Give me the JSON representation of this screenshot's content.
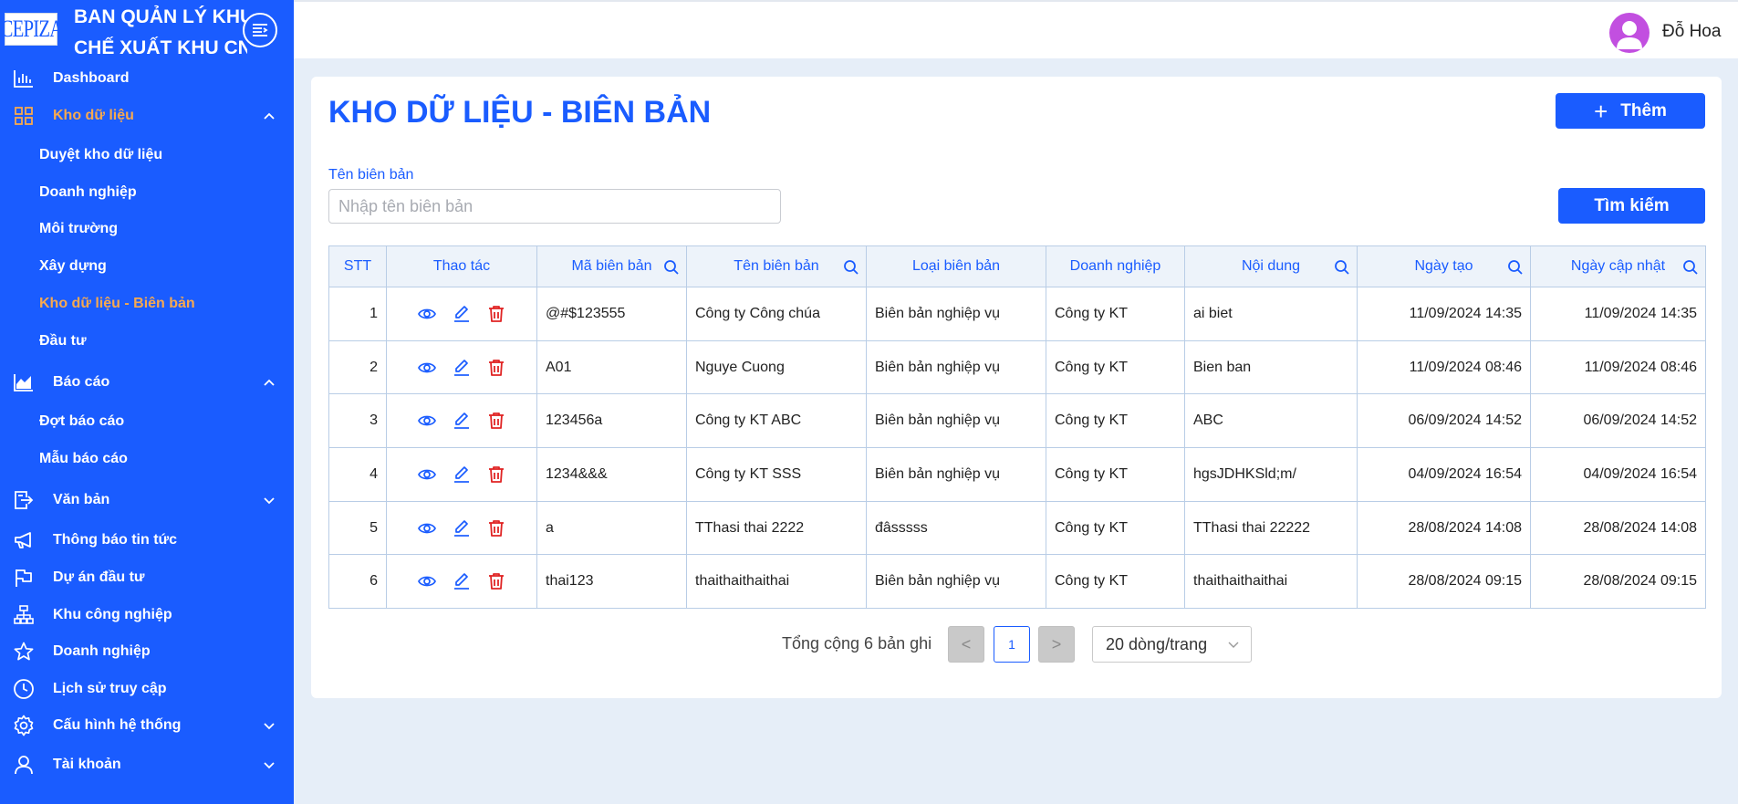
{
  "brand": {
    "logo_text": "CEPIZA",
    "title_line1": "BAN QUẢN LÝ KHU",
    "title_line2": "CHẾ XUẤT KHU CN"
  },
  "sidebar": {
    "items": [
      {
        "label": "Dashboard",
        "icon": "bar-chart-icon"
      },
      {
        "label": "Kho dữ liệu",
        "icon": "grid-icon",
        "expanded": true
      },
      {
        "label": "Duyệt kho dữ liệu"
      },
      {
        "label": "Doanh nghiệp"
      },
      {
        "label": "Môi trường"
      },
      {
        "label": "Xây dựng"
      },
      {
        "label": "Kho dữ liệu - Biên bản",
        "active": true
      },
      {
        "label": "Đầu tư"
      },
      {
        "label": "Báo cáo",
        "icon": "area-chart-icon",
        "expanded": true
      },
      {
        "label": "Đợt báo cáo"
      },
      {
        "label": "Mẫu báo cáo"
      },
      {
        "label": "Văn bản",
        "icon": "document-export-icon"
      },
      {
        "label": "Thông báo tin tức",
        "icon": "megaphone-icon"
      },
      {
        "label": "Dự án đầu tư",
        "icon": "flag-icon"
      },
      {
        "label": "Khu công nghiệp",
        "icon": "org-chart-icon"
      },
      {
        "label": "Doanh nghiệp",
        "icon": "star-icon"
      },
      {
        "label": "Lịch sử truy cập",
        "icon": "clock-icon"
      },
      {
        "label": "Cấu hình hệ thống",
        "icon": "gear-icon"
      },
      {
        "label": "Tài khoản",
        "icon": "user-icon"
      }
    ]
  },
  "header": {
    "user_name": "Đỗ Hoa"
  },
  "page": {
    "title": "KHO DỮ LIỆU - BIÊN BẢN",
    "add_button": "Thêm",
    "search_label": "Tên biên bản",
    "search_placeholder": "Nhập tên biên bản",
    "search_value": "",
    "search_button": "Tìm kiếm"
  },
  "table": {
    "columns": [
      "STT",
      "Thao tác",
      "Mã biên bản",
      "Tên biên bản",
      "Loại biên bản",
      "Doanh nghiệp",
      "Nội dung",
      "Ngày tạo",
      "Ngày cập nhật"
    ],
    "rows": [
      {
        "stt": "1",
        "ma": "@#$123555",
        "ten": "Công ty Công chúa",
        "loai": "Biên bản nghiệp vụ",
        "dn": "Công ty KT",
        "nd": "ai biet",
        "tao": "11/09/2024 14:35",
        "cn": "11/09/2024 14:35"
      },
      {
        "stt": "2",
        "ma": "A01",
        "ten": "Nguye Cuong",
        "loai": "Biên bản nghiệp vụ",
        "dn": "Công ty KT",
        "nd": "Bien ban",
        "tao": "11/09/2024 08:46",
        "cn": "11/09/2024 08:46"
      },
      {
        "stt": "3",
        "ma": "123456a",
        "ten": "Công ty KT ABC",
        "loai": "Biên bản nghiệp vụ",
        "dn": "Công ty KT",
        "nd": "ABC",
        "tao": "06/09/2024 14:52",
        "cn": "06/09/2024 14:52"
      },
      {
        "stt": "4",
        "ma": "1234&&&",
        "ten": "Công ty KT SSS",
        "loai": "Biên bản nghiệp vụ",
        "dn": "Công ty KT",
        "nd": "hgsJDHKSld;m/",
        "tao": "04/09/2024 16:54",
        "cn": "04/09/2024 16:54"
      },
      {
        "stt": "5",
        "ma": "a",
        "ten": "TThasi thai 2222",
        "loai": "đâsssss",
        "dn": "Công ty KT",
        "nd": "TThasi thai 22222",
        "tao": "28/08/2024 14:08",
        "cn": "28/08/2024 14:08"
      },
      {
        "stt": "6",
        "ma": "thai123",
        "ten": "thaithaithaithai",
        "loai": "Biên bản nghiệp vụ",
        "dn": "Công ty KT",
        "nd": "thaithaithaithai",
        "tao": "28/08/2024 09:15",
        "cn": "28/08/2024 09:15"
      }
    ]
  },
  "pagination": {
    "total_text": "Tổng cộng 6 bản ghi",
    "prev": "<",
    "current_page": "1",
    "next": ">",
    "page_size": "20 dòng/trang"
  },
  "colors": {
    "primary": "#1a5cff",
    "active_menu": "#f7a94f",
    "delete": "#e02424",
    "avatar": "#c24fe0"
  }
}
